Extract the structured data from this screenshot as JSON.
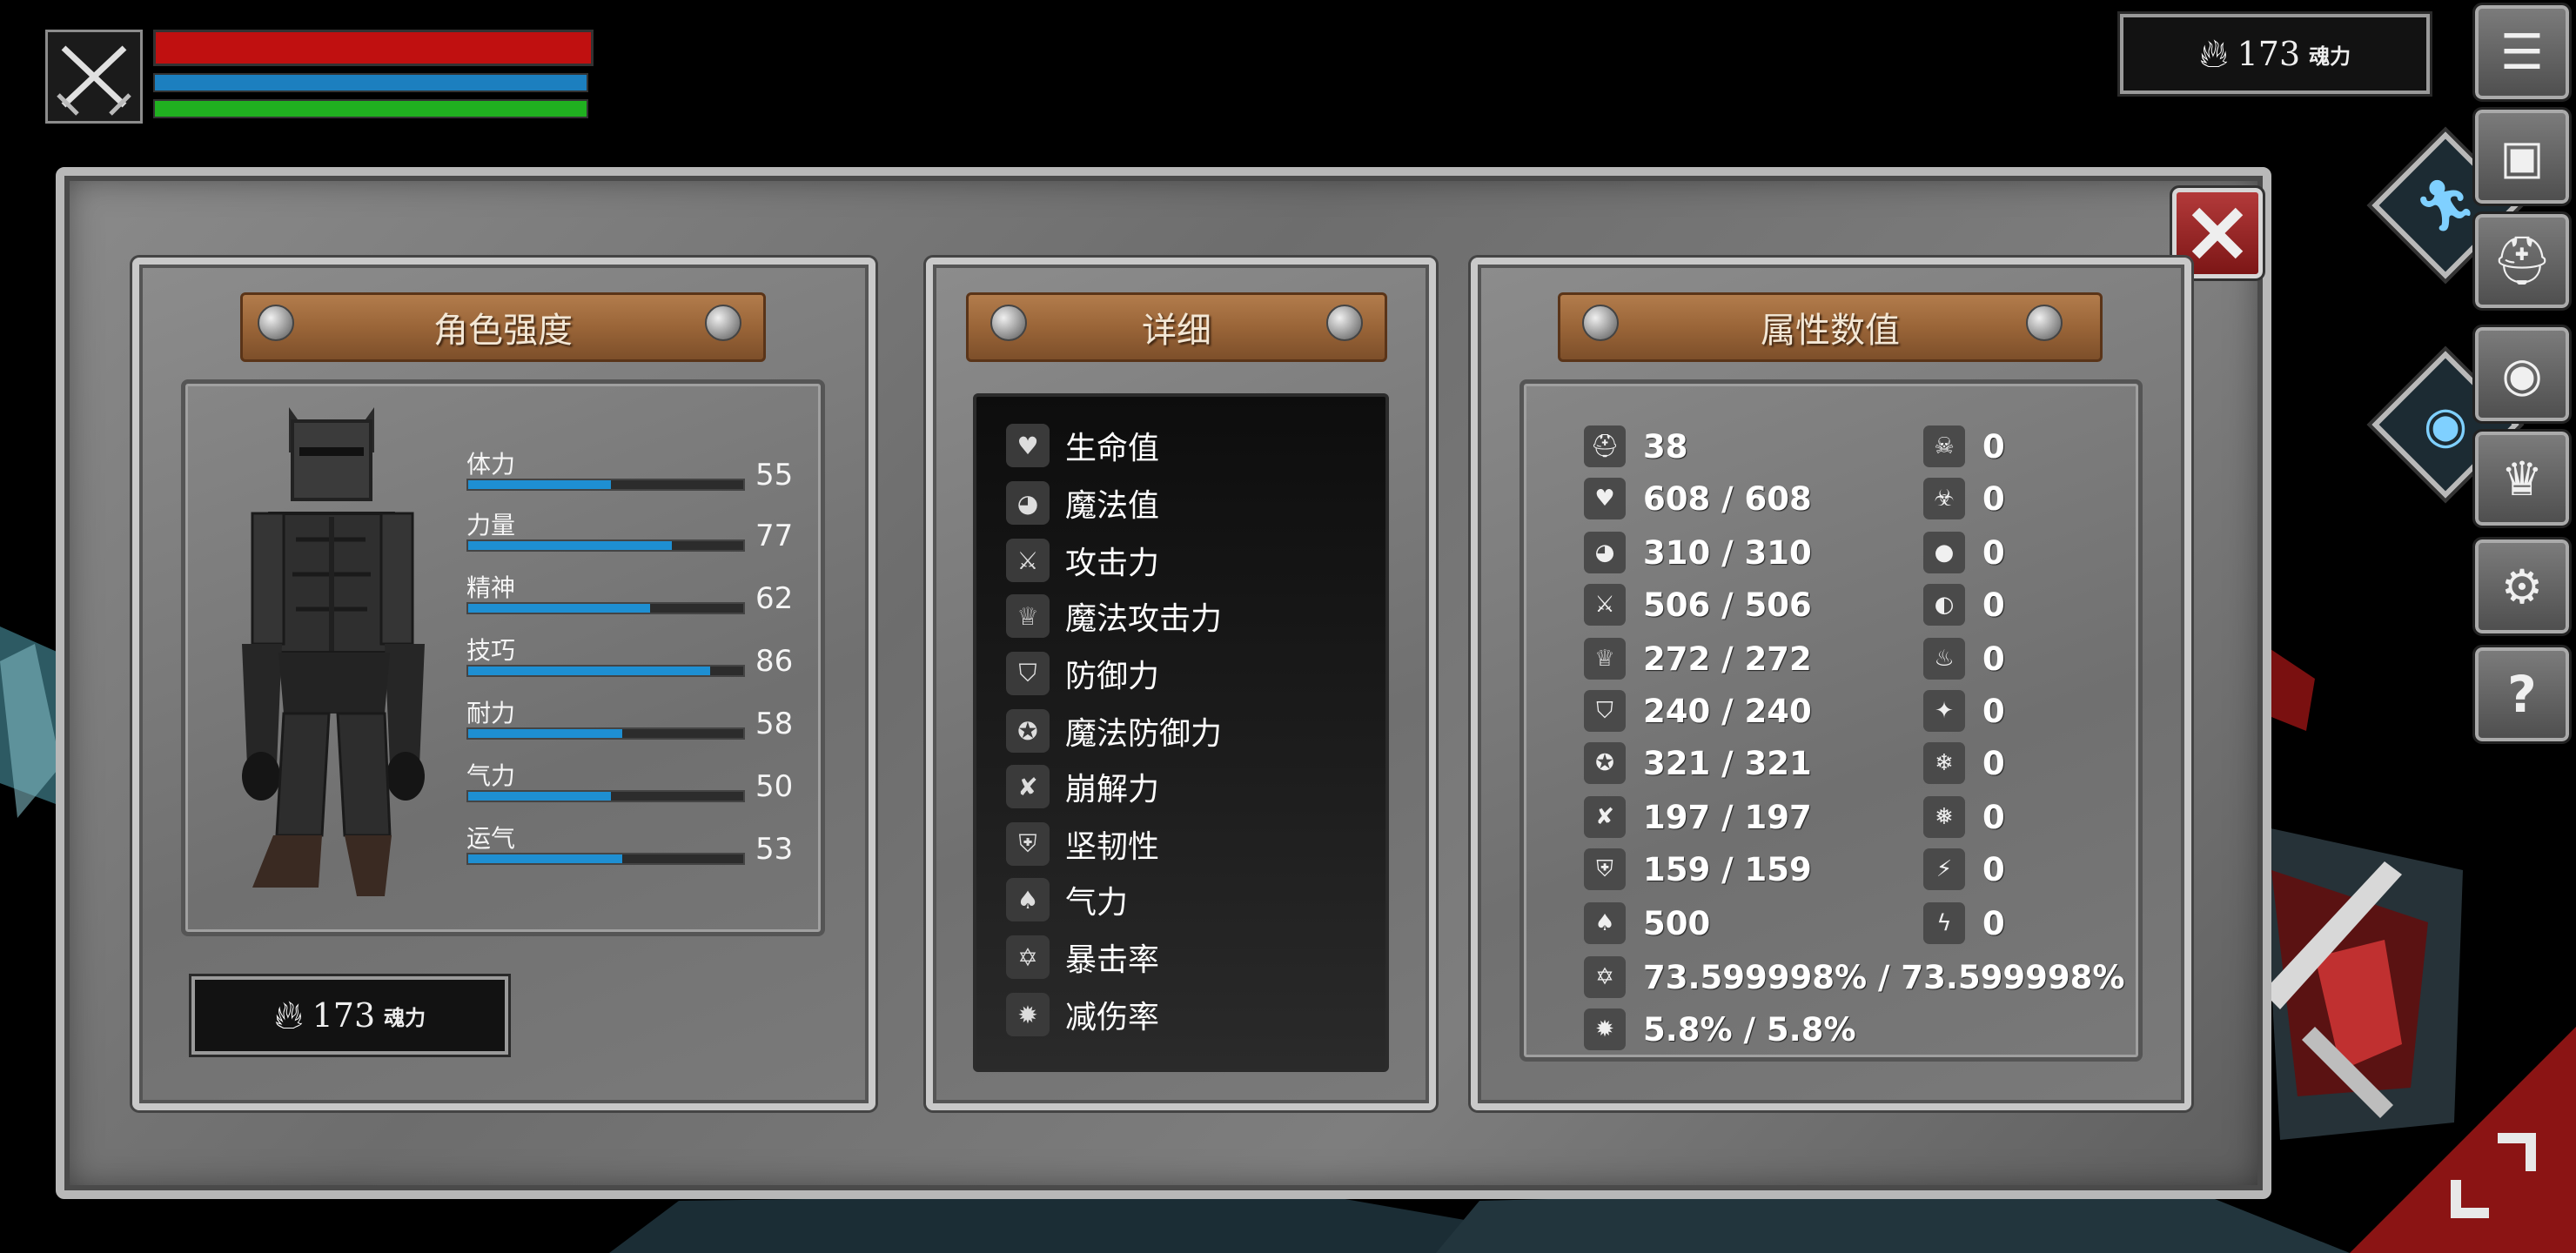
{
  "hud": {
    "health_color": "#c01010",
    "mana_color": "#1c7fbf",
    "stamina_color": "#20b020",
    "portrait_icon": "crossed-swords-icon"
  },
  "soul_top": {
    "value": "173",
    "unit": "魂力",
    "icon": "fire-icon"
  },
  "side_buttons": [
    {
      "name": "menu",
      "icon": "list-icon",
      "glyph": "☰"
    },
    {
      "name": "inventory",
      "icon": "backpack-icon",
      "glyph": "▣"
    },
    {
      "name": "helmet",
      "icon": "helmet-icon",
      "glyph": "⛑"
    },
    {
      "name": "skills",
      "icon": "emblem-icon",
      "glyph": "◉"
    },
    {
      "name": "crown",
      "icon": "crown-icon",
      "glyph": "♛"
    },
    {
      "name": "settings",
      "icon": "gear-icon",
      "glyph": "⚙"
    },
    {
      "name": "help",
      "icon": "question-icon",
      "glyph": "?"
    }
  ],
  "panel_strength": {
    "title": "角色强度",
    "stats": [
      {
        "label": "体力",
        "value": "55",
        "fill": 0.52
      },
      {
        "label": "力量",
        "value": "77",
        "fill": 0.74
      },
      {
        "label": "精神",
        "value": "62",
        "fill": 0.66
      },
      {
        "label": "技巧",
        "value": "86",
        "fill": 0.88
      },
      {
        "label": "耐力",
        "value": "58",
        "fill": 0.56
      },
      {
        "label": "气力",
        "value": "50",
        "fill": 0.52
      },
      {
        "label": "运气",
        "value": "53",
        "fill": 0.56
      }
    ],
    "soul": {
      "value": "173",
      "unit": "魂力"
    }
  },
  "panel_detail": {
    "title": "详细",
    "items": [
      {
        "label": "生命值",
        "icon": "heart-icon",
        "glyph": "♥"
      },
      {
        "label": "魔法值",
        "icon": "head-icon",
        "glyph": "◕"
      },
      {
        "label": "攻击力",
        "icon": "sword-icon",
        "glyph": "⚔"
      },
      {
        "label": "魔法攻击力",
        "icon": "spellbook-icon",
        "glyph": "♕"
      },
      {
        "label": "防御力",
        "icon": "shield-icon",
        "glyph": "⛉"
      },
      {
        "label": "魔法防御力",
        "icon": "magic-shield-icon",
        "glyph": "✪"
      },
      {
        "label": "崩解力",
        "icon": "break-icon",
        "glyph": "✘"
      },
      {
        "label": "坚韧性",
        "icon": "knight-helmet-icon",
        "glyph": "⛨"
      },
      {
        "label": "气力",
        "icon": "lungs-icon",
        "glyph": "♠"
      },
      {
        "label": "暴击率",
        "icon": "star-burst-icon",
        "glyph": "✡"
      },
      {
        "label": "减伤率",
        "icon": "badge-shield-icon",
        "glyph": "✹"
      }
    ]
  },
  "panel_attributes": {
    "title": "属性数值",
    "left": [
      {
        "icon": "helmet-icon",
        "glyph": "⛑",
        "value": "38"
      },
      {
        "icon": "heart-icon",
        "glyph": "♥",
        "value": "608 / 608"
      },
      {
        "icon": "head-icon",
        "glyph": "◕",
        "value": "310 / 310"
      },
      {
        "icon": "sword-icon",
        "glyph": "⚔",
        "value": "506 / 506"
      },
      {
        "icon": "spellbook-icon",
        "glyph": "♕",
        "value": "272 / 272"
      },
      {
        "icon": "shield-icon",
        "glyph": "⛉",
        "value": "240 / 240"
      },
      {
        "icon": "magic-shield-icon",
        "glyph": "✪",
        "value": "321 / 321"
      },
      {
        "icon": "break-icon",
        "glyph": "✘",
        "value": "197 / 197"
      },
      {
        "icon": "knight-helmet-icon",
        "glyph": "⛨",
        "value": "159 / 159"
      },
      {
        "icon": "lungs-icon",
        "glyph": "♠",
        "value": "500"
      },
      {
        "icon": "star-burst-icon",
        "glyph": "✡",
        "value": "73.599998% / 73.599998%"
      },
      {
        "icon": "badge-shield-icon",
        "glyph": "✹",
        "value": "5.8% / 5.8%"
      }
    ],
    "right": [
      {
        "icon": "skull-icon",
        "glyph": "☠",
        "value": "0"
      },
      {
        "icon": "poison-resist-icon",
        "glyph": "☣",
        "value": "0"
      },
      {
        "icon": "blood-drop-icon",
        "glyph": "●",
        "value": "0"
      },
      {
        "icon": "bleed-resist-icon",
        "glyph": "◐",
        "value": "0"
      },
      {
        "icon": "flame-icon",
        "glyph": "♨",
        "value": "0"
      },
      {
        "icon": "fire-resist-icon",
        "glyph": "✦",
        "value": "0"
      },
      {
        "icon": "snowflake-icon",
        "glyph": "❄",
        "value": "0"
      },
      {
        "icon": "frost-resist-icon",
        "glyph": "❅",
        "value": "0"
      },
      {
        "icon": "lightning-icon",
        "glyph": "⚡",
        "value": "0"
      },
      {
        "icon": "lightning-resist-icon",
        "glyph": "ϟ",
        "value": "0"
      }
    ]
  }
}
